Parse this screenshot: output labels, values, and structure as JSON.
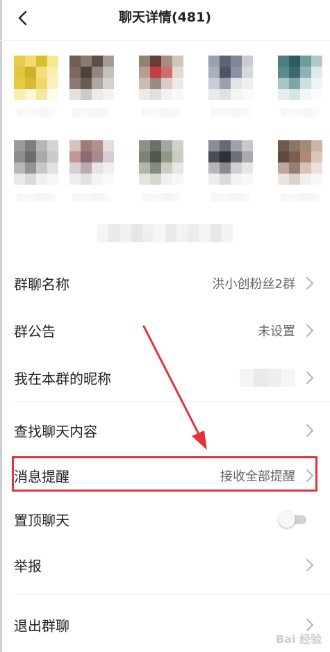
{
  "header": {
    "title": "聊天详情(481)",
    "back_icon": "back-chevron-icon"
  },
  "settings": [
    {
      "label": "群聊名称",
      "value": "洪小创粉丝2群"
    },
    {
      "label": "群公告",
      "value": "未设置"
    },
    {
      "label": "我在本群的昵称",
      "value": ""
    },
    {
      "label": "查找聊天内容",
      "value": ""
    },
    {
      "label": "消息提醒",
      "value": "接收全部提醒"
    },
    {
      "label": "置顶聊天",
      "toggle_on": false
    },
    {
      "label": "举报",
      "value": ""
    },
    {
      "label": "退出群聊",
      "value": ""
    }
  ],
  "annotation": {
    "highlight_color": "#e2333b",
    "arrow_color": "#e2333b"
  },
  "watermark": {
    "text": "Bai 经验"
  }
}
